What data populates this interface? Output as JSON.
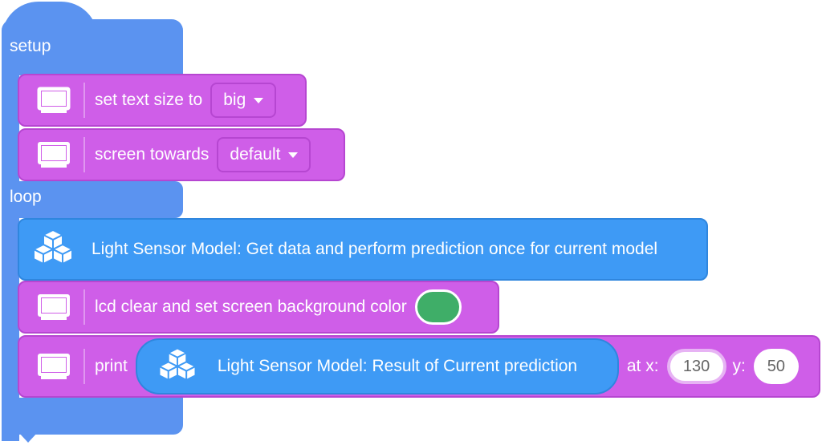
{
  "hat": {
    "setup_label": "setup",
    "loop_label": "loop"
  },
  "blocks": {
    "set_text_size": {
      "label": "set text size to",
      "value": "big"
    },
    "screen_towards": {
      "label": "screen towards",
      "value": "default"
    },
    "light_sensor_predict": {
      "label": "Light Sensor Model: Get data and perform prediction once for current model"
    },
    "lcd_clear": {
      "label": "lcd clear and set screen background color",
      "color": "#3fae68"
    },
    "print": {
      "label": "print",
      "reporter": "Light Sensor Model: Result of Current prediction",
      "at_x_label": "at x:",
      "x_value": "130",
      "y_label": "y:",
      "y_value": "50"
    }
  },
  "colors": {
    "hat_blue": "#5b93f0",
    "block_purple": "#cf5ee8",
    "block_blue": "#3e9af5",
    "swatch_green": "#3fae68"
  },
  "icons": [
    "screen-icon",
    "cubes-icon",
    "caret-down-icon"
  ]
}
